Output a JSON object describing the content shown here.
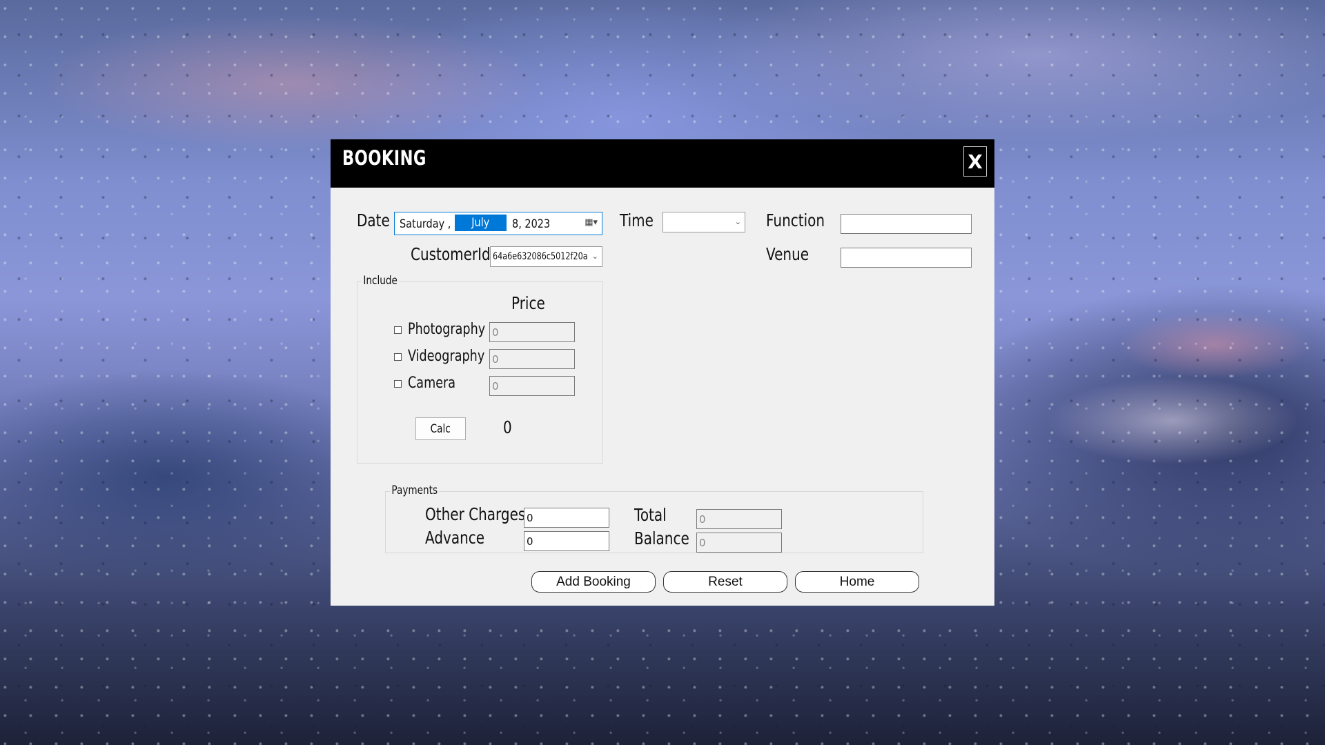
{
  "dialog": {
    "title": "BOOKING",
    "close_label": "X"
  },
  "date": {
    "label": "Date",
    "weekday": "Saturday ,",
    "month": "July",
    "day_year": "8, 2023",
    "icon": "calendar-dropdown-icon"
  },
  "time": {
    "label": "Time",
    "value": ""
  },
  "function": {
    "label": "Function",
    "value": ""
  },
  "venue": {
    "label": "Venue",
    "value": ""
  },
  "customer": {
    "label": "CustomerId",
    "value": "64a6e632086c5012f20a"
  },
  "include": {
    "title": "Include",
    "price_header": "Price",
    "items": [
      {
        "label": "Photography",
        "checked": false,
        "price": "0"
      },
      {
        "label": "Videography",
        "checked": false,
        "price": "0"
      },
      {
        "label": "Camera",
        "checked": false,
        "price": "0"
      }
    ],
    "calc_label": "Calc",
    "calc_result": "0"
  },
  "payments": {
    "title": "Payments",
    "other_charges_label": "Other Charges",
    "other_charges_value": "0",
    "advance_label": "Advance",
    "advance_value": "0",
    "total_label": "Total",
    "total_value": "0",
    "balance_label": "Balance",
    "balance_value": "0"
  },
  "actions": {
    "add_booking": "Add Booking",
    "reset": "Reset",
    "home": "Home"
  }
}
